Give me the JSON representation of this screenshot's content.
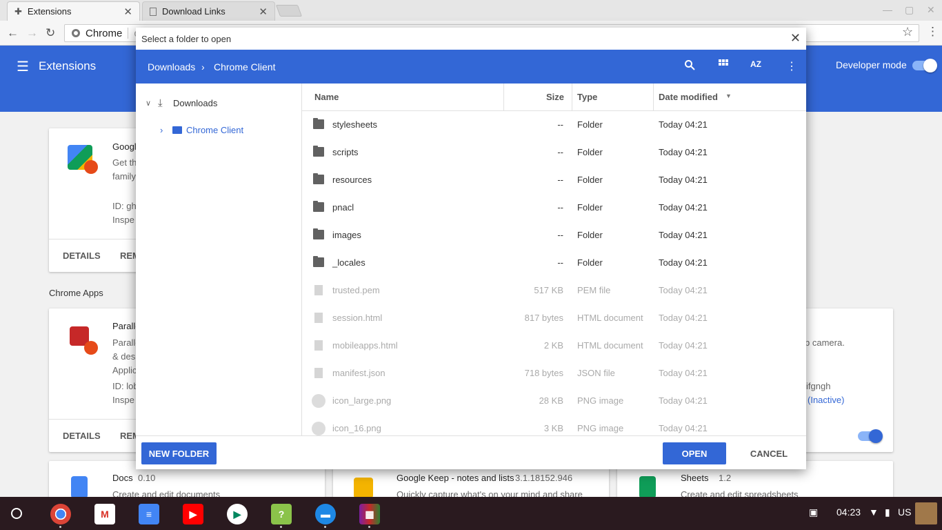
{
  "browser": {
    "tabs": [
      {
        "title": "Extensions",
        "icon": "puzzle-icon"
      },
      {
        "title": "Download Links",
        "icon": "page-icon"
      }
    ],
    "omnibox_scheme": "Chrome",
    "omnibox_url": "ch"
  },
  "extensions_page": {
    "title": "Extensions",
    "developer_mode_label": "Developer mode",
    "developer_mode_on": true,
    "cards": [
      {
        "name": "Googl",
        "desc1": "Get th",
        "desc2": "family",
        "id": "ID: gh",
        "inspect": "Inspe",
        "details": "DETAILS",
        "remove": "REM"
      },
      {
        "name": "Paralle",
        "desc1": "Paralle",
        "desc2": "& desk",
        "desc3": "Applic",
        "id": "ID: lob",
        "inspect": "Inspe",
        "details": "DETAILS",
        "remove": "REM"
      }
    ],
    "section_chrome_apps": "Chrome Apps",
    "right_card": {
      "desc": "b camera.",
      "id_tail": "ifgngh",
      "inactive": "(Inactive)"
    },
    "bottom_apps": [
      {
        "name": "Docs",
        "version": "0.10",
        "desc": "Create and edit documents"
      },
      {
        "name": "Google Keep - notes and lists",
        "version": "3.1.18152.946",
        "desc": "Quickly capture what's on your mind and share"
      },
      {
        "name": "Sheets",
        "version": "1.2",
        "desc": "Create and edit spreadsheets"
      }
    ]
  },
  "dialog": {
    "title": "Select a folder to open",
    "breadcrumb": [
      "Downloads",
      "Chrome Client"
    ],
    "tree": {
      "root": "Downloads",
      "child": "Chrome Client"
    },
    "columns": {
      "name": "Name",
      "size": "Size",
      "type": "Type",
      "date": "Date modified"
    },
    "rows": [
      {
        "name": "stylesheets",
        "size": "--",
        "type": "Folder",
        "date": "Today 04:21",
        "kind": "folder"
      },
      {
        "name": "scripts",
        "size": "--",
        "type": "Folder",
        "date": "Today 04:21",
        "kind": "folder"
      },
      {
        "name": "resources",
        "size": "--",
        "type": "Folder",
        "date": "Today 04:21",
        "kind": "folder"
      },
      {
        "name": "pnacl",
        "size": "--",
        "type": "Folder",
        "date": "Today 04:21",
        "kind": "folder"
      },
      {
        "name": "images",
        "size": "--",
        "type": "Folder",
        "date": "Today 04:21",
        "kind": "folder"
      },
      {
        "name": "_locales",
        "size": "--",
        "type": "Folder",
        "date": "Today 04:21",
        "kind": "folder"
      },
      {
        "name": "trusted.pem",
        "size": "517 KB",
        "type": "PEM file",
        "date": "Today 04:21",
        "kind": "doc"
      },
      {
        "name": "session.html",
        "size": "817 bytes",
        "type": "HTML document",
        "date": "Today 04:21",
        "kind": "doc"
      },
      {
        "name": "mobileapps.html",
        "size": "2 KB",
        "type": "HTML document",
        "date": "Today 04:21",
        "kind": "doc"
      },
      {
        "name": "manifest.json",
        "size": "718 bytes",
        "type": "JSON file",
        "date": "Today 04:21",
        "kind": "doc"
      },
      {
        "name": "icon_large.png",
        "size": "28 KB",
        "type": "PNG image",
        "date": "Today 04:21",
        "kind": "img"
      },
      {
        "name": "icon_16.png",
        "size": "3 KB",
        "type": "PNG image",
        "date": "Today 04:21",
        "kind": "img"
      }
    ],
    "new_folder": "NEW FOLDER",
    "open": "OPEN",
    "cancel": "CANCEL"
  },
  "shelf": {
    "apps": [
      "chrome",
      "gmail",
      "docs",
      "youtube",
      "play-store",
      "quiz-app",
      "files",
      "archive-app"
    ],
    "time": "04:23",
    "locale": "US"
  }
}
